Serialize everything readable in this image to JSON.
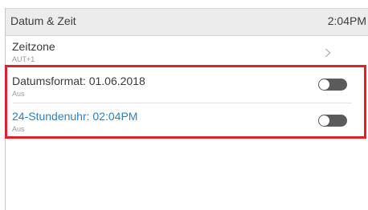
{
  "header": {
    "title": "Datum & Zeit",
    "clock": "2:04PM"
  },
  "settings": {
    "timezone": {
      "label": "Zeitzone",
      "value": "AUT+1",
      "icon": "chevron-right-icon"
    },
    "date_format": {
      "label": "Datumsformat: 01.06.2018",
      "status": "Aus",
      "toggle_on": false
    },
    "clock_24h": {
      "label": "24-Stundenuhr: 02:04PM",
      "status": "Aus",
      "toggle_on": false
    }
  },
  "colors": {
    "highlight": "#e0202a",
    "active_label": "#2f7fc1",
    "header_bg": "#ececec",
    "toggle_track": "#5b5b5b"
  }
}
